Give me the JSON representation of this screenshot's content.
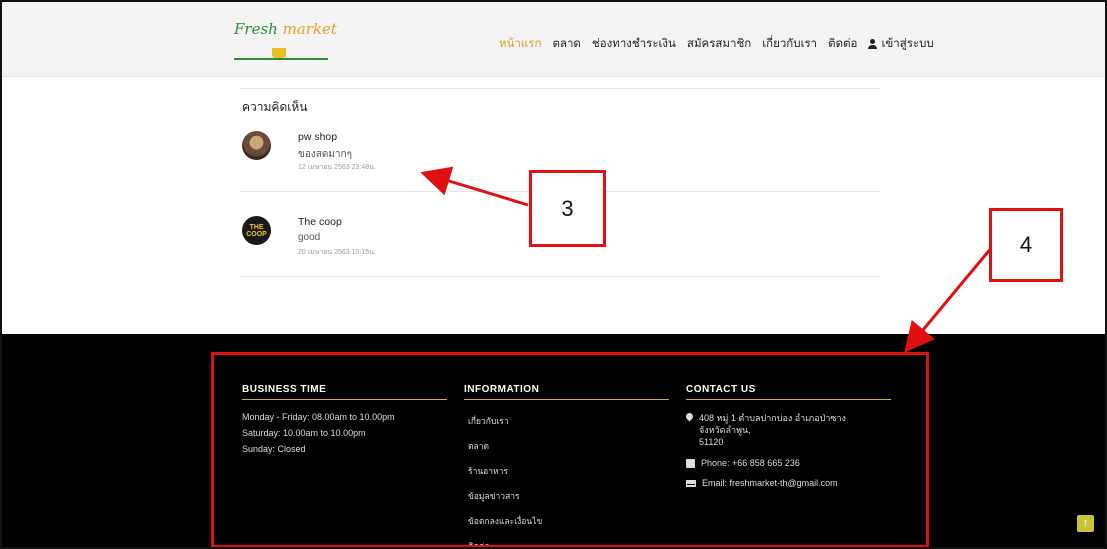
{
  "header": {
    "logo_text_main": "Fresh",
    "logo_text_accent": "market",
    "nav": [
      {
        "label": "หน้าแรก",
        "active": true
      },
      {
        "label": "ตลาด",
        "active": false
      },
      {
        "label": "ช่องทางชำระเงิน",
        "active": false
      },
      {
        "label": "สมัครสมาชิก",
        "active": false
      },
      {
        "label": "เกี่ยวกับเรา",
        "active": false
      },
      {
        "label": "ติดต่อ",
        "active": false
      }
    ],
    "login_label": "เข้าสู่ระบบ",
    "active_color": "#d6a52a"
  },
  "comments": {
    "title": "ความคิดเห็น",
    "items": [
      {
        "author": "pw shop",
        "text": "ของสดมากๆ",
        "date": "12 เมษายน 2563 23:48น."
      },
      {
        "author": "The coop",
        "text": "good",
        "date": "20 เมษายน 2563 10:15น.",
        "avatar_text": "THE COOP"
      }
    ]
  },
  "footer": {
    "business": {
      "title": "BUSINESS TIME",
      "lines": [
        "Monday - Friday: 08.00am to 10.00pm",
        "Saturday: 10.00am to 10.00pm",
        "Sunday: Closed"
      ]
    },
    "information": {
      "title": "INFORMATION",
      "links": [
        "เกี่ยวกับเรา",
        "ตลาด",
        "ร้านอาหาร",
        "ข้อมูลข่าวสาร",
        "ข้อตกลงและเงื่อนไข",
        "ติดต่อ"
      ]
    },
    "contact": {
      "title": "CONTACT US",
      "address_lines": [
        "408 หมู่ 1 ตำบลปากบ่อง อำเภอป่าซาง",
        "จังหวัดลำพูน,",
        "51120"
      ],
      "phone": "Phone: +66 858 665 236",
      "email": "Email: freshmarket-th@gmail.com"
    },
    "divider_color": "#c8b23a"
  },
  "scroll_top_symbol": "↑",
  "annotations": {
    "label_3": "3",
    "label_4": "4",
    "color": "#e01010"
  }
}
